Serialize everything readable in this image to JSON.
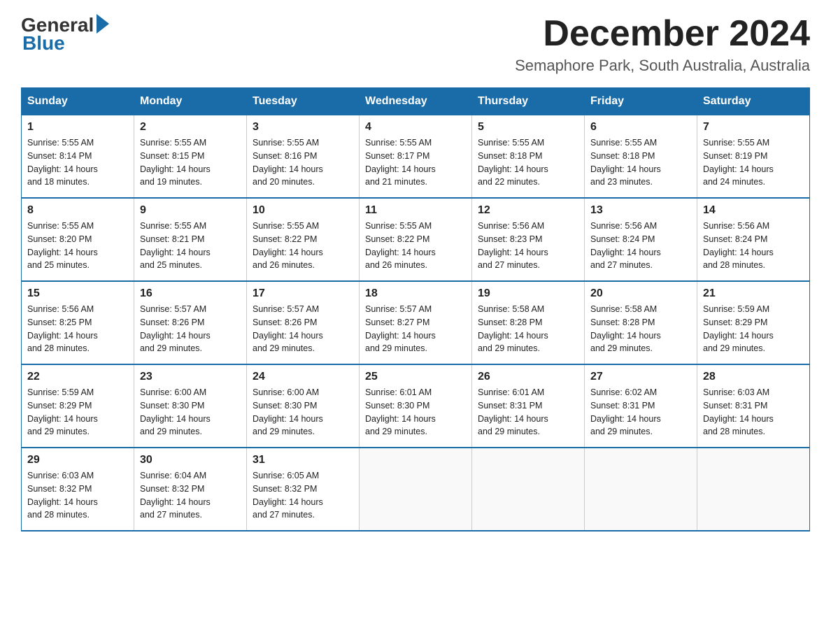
{
  "logo": {
    "general": "General",
    "blue": "Blue"
  },
  "title": "December 2024",
  "subtitle": "Semaphore Park, South Australia, Australia",
  "days_of_week": [
    "Sunday",
    "Monday",
    "Tuesday",
    "Wednesday",
    "Thursday",
    "Friday",
    "Saturday"
  ],
  "weeks": [
    [
      {
        "day": "1",
        "sunrise": "5:55 AM",
        "sunset": "8:14 PM",
        "daylight": "14 hours and 18 minutes."
      },
      {
        "day": "2",
        "sunrise": "5:55 AM",
        "sunset": "8:15 PM",
        "daylight": "14 hours and 19 minutes."
      },
      {
        "day": "3",
        "sunrise": "5:55 AM",
        "sunset": "8:16 PM",
        "daylight": "14 hours and 20 minutes."
      },
      {
        "day": "4",
        "sunrise": "5:55 AM",
        "sunset": "8:17 PM",
        "daylight": "14 hours and 21 minutes."
      },
      {
        "day": "5",
        "sunrise": "5:55 AM",
        "sunset": "8:18 PM",
        "daylight": "14 hours and 22 minutes."
      },
      {
        "day": "6",
        "sunrise": "5:55 AM",
        "sunset": "8:18 PM",
        "daylight": "14 hours and 23 minutes."
      },
      {
        "day": "7",
        "sunrise": "5:55 AM",
        "sunset": "8:19 PM",
        "daylight": "14 hours and 24 minutes."
      }
    ],
    [
      {
        "day": "8",
        "sunrise": "5:55 AM",
        "sunset": "8:20 PM",
        "daylight": "14 hours and 25 minutes."
      },
      {
        "day": "9",
        "sunrise": "5:55 AM",
        "sunset": "8:21 PM",
        "daylight": "14 hours and 25 minutes."
      },
      {
        "day": "10",
        "sunrise": "5:55 AM",
        "sunset": "8:22 PM",
        "daylight": "14 hours and 26 minutes."
      },
      {
        "day": "11",
        "sunrise": "5:55 AM",
        "sunset": "8:22 PM",
        "daylight": "14 hours and 26 minutes."
      },
      {
        "day": "12",
        "sunrise": "5:56 AM",
        "sunset": "8:23 PM",
        "daylight": "14 hours and 27 minutes."
      },
      {
        "day": "13",
        "sunrise": "5:56 AM",
        "sunset": "8:24 PM",
        "daylight": "14 hours and 27 minutes."
      },
      {
        "day": "14",
        "sunrise": "5:56 AM",
        "sunset": "8:24 PM",
        "daylight": "14 hours and 28 minutes."
      }
    ],
    [
      {
        "day": "15",
        "sunrise": "5:56 AM",
        "sunset": "8:25 PM",
        "daylight": "14 hours and 28 minutes."
      },
      {
        "day": "16",
        "sunrise": "5:57 AM",
        "sunset": "8:26 PM",
        "daylight": "14 hours and 29 minutes."
      },
      {
        "day": "17",
        "sunrise": "5:57 AM",
        "sunset": "8:26 PM",
        "daylight": "14 hours and 29 minutes."
      },
      {
        "day": "18",
        "sunrise": "5:57 AM",
        "sunset": "8:27 PM",
        "daylight": "14 hours and 29 minutes."
      },
      {
        "day": "19",
        "sunrise": "5:58 AM",
        "sunset": "8:28 PM",
        "daylight": "14 hours and 29 minutes."
      },
      {
        "day": "20",
        "sunrise": "5:58 AM",
        "sunset": "8:28 PM",
        "daylight": "14 hours and 29 minutes."
      },
      {
        "day": "21",
        "sunrise": "5:59 AM",
        "sunset": "8:29 PM",
        "daylight": "14 hours and 29 minutes."
      }
    ],
    [
      {
        "day": "22",
        "sunrise": "5:59 AM",
        "sunset": "8:29 PM",
        "daylight": "14 hours and 29 minutes."
      },
      {
        "day": "23",
        "sunrise": "6:00 AM",
        "sunset": "8:30 PM",
        "daylight": "14 hours and 29 minutes."
      },
      {
        "day": "24",
        "sunrise": "6:00 AM",
        "sunset": "8:30 PM",
        "daylight": "14 hours and 29 minutes."
      },
      {
        "day": "25",
        "sunrise": "6:01 AM",
        "sunset": "8:30 PM",
        "daylight": "14 hours and 29 minutes."
      },
      {
        "day": "26",
        "sunrise": "6:01 AM",
        "sunset": "8:31 PM",
        "daylight": "14 hours and 29 minutes."
      },
      {
        "day": "27",
        "sunrise": "6:02 AM",
        "sunset": "8:31 PM",
        "daylight": "14 hours and 29 minutes."
      },
      {
        "day": "28",
        "sunrise": "6:03 AM",
        "sunset": "8:31 PM",
        "daylight": "14 hours and 28 minutes."
      }
    ],
    [
      {
        "day": "29",
        "sunrise": "6:03 AM",
        "sunset": "8:32 PM",
        "daylight": "14 hours and 28 minutes."
      },
      {
        "day": "30",
        "sunrise": "6:04 AM",
        "sunset": "8:32 PM",
        "daylight": "14 hours and 27 minutes."
      },
      {
        "day": "31",
        "sunrise": "6:05 AM",
        "sunset": "8:32 PM",
        "daylight": "14 hours and 27 minutes."
      },
      null,
      null,
      null,
      null
    ]
  ],
  "labels": {
    "sunrise": "Sunrise:",
    "sunset": "Sunset:",
    "daylight": "Daylight:"
  }
}
